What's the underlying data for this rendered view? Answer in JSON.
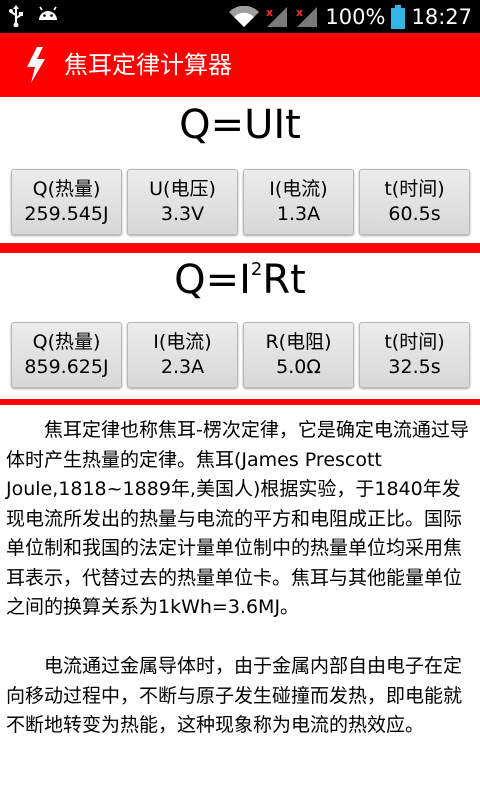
{
  "status_bar": {
    "battery_percent": "100%",
    "time": "18:27",
    "icons": [
      "usb-icon",
      "android-icon",
      "wifi-icon",
      "signal-x-icon",
      "signal-x-icon",
      "battery-icon"
    ]
  },
  "header": {
    "title": "焦耳定律计算器",
    "background": "#ff0000"
  },
  "section1": {
    "formula_main": "Q=UIt",
    "buttons": [
      {
        "label": "Q(热量)",
        "value": "259.545J"
      },
      {
        "label": "U(电压)",
        "value": "3.3V"
      },
      {
        "label": "I(电流)",
        "value": "1.3A"
      },
      {
        "label": "t(时间)",
        "value": "60.5s"
      }
    ]
  },
  "section2": {
    "formula_prefix": "Q=I",
    "formula_sup": "2",
    "formula_suffix": "Rt",
    "buttons": [
      {
        "label": "Q(热量)",
        "value": "859.625J"
      },
      {
        "label": "I(电流)",
        "value": "2.3A"
      },
      {
        "label": "R(电阻)",
        "value": "5.0Ω"
      },
      {
        "label": "t(时间)",
        "value": "32.5s"
      }
    ]
  },
  "description": {
    "p1": "焦耳定律也称焦耳-楞次定律，它是确定电流通过导体时产生热量的定律。焦耳(James Prescott Joule,1818~1889年,美国人)根据实验，于1840年发现电流所发出的热量与电流的平方和电阻成正比。国际单位制和我国的法定计量单位制中的热量单位均采用焦耳表示，代替过去的热量单位卡。焦耳与其他能量单位之间的换算关系为1kWh=3.6MJ。",
    "p2": "电流通过金属导体时，由于金属内部自由电子在定向移动过程中，不断与原子发生碰撞而发热，即电能就不断地转变为热能，这种现象称为电流的热效应。"
  }
}
